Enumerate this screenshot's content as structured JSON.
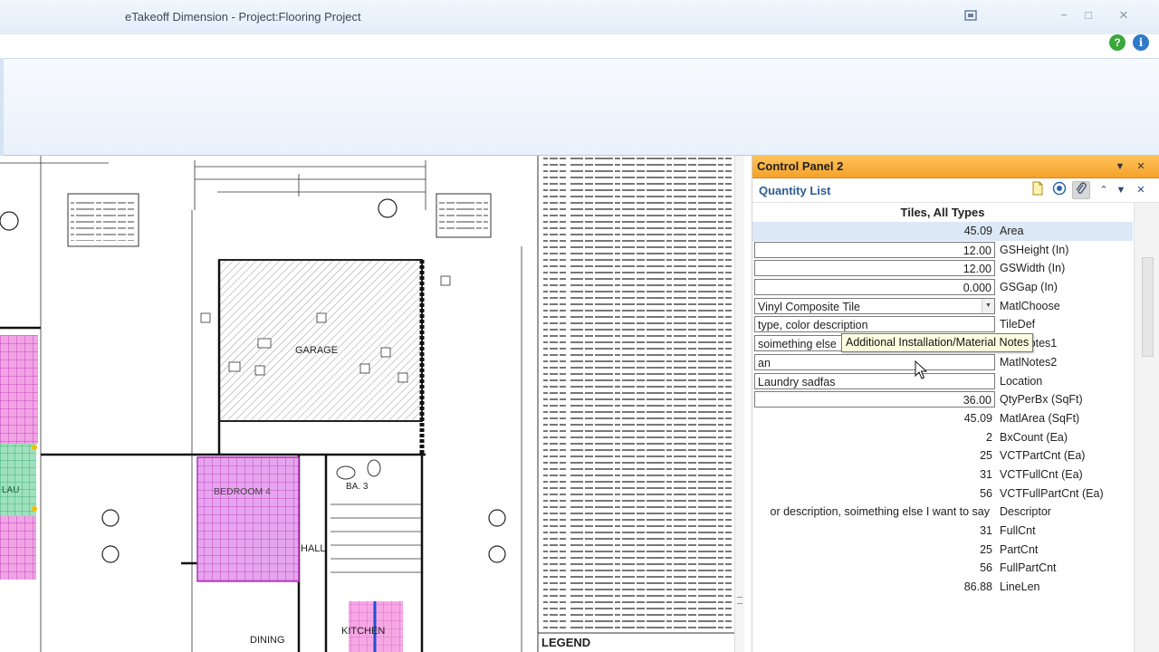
{
  "window": {
    "title": "eTakeoff Dimension - Project:Flooring Project",
    "controls": {
      "minimize": "−",
      "maximize": "□",
      "close": "✕"
    },
    "help_button": "?",
    "info_button": "i"
  },
  "drawing": {
    "room_labels": {
      "garage": "GARAGE",
      "bedroom": "BEDROOM 4",
      "bath": "BA. 3",
      "hall": "HALL",
      "dining": "DINING",
      "kitchen": "KITCHEN",
      "laundry": "LAU"
    },
    "legend": "LEGEND"
  },
  "control_panel": {
    "title": "Control Panel 2",
    "quantity_list": {
      "title": "Quantity List",
      "group_title": "Tiles, All Types",
      "rows": [
        {
          "value": "45.09",
          "label": "Area"
        },
        {
          "value": "12.00",
          "label": "GSHeight (In)"
        },
        {
          "value": "12.00",
          "label": "GSWidth (In)"
        },
        {
          "value": "0.000",
          "label": "GSGap (In)"
        },
        {
          "value": "Vinyl Composite Tile",
          "label": "MatlChoose"
        },
        {
          "value": "type, color description",
          "label": "TileDef"
        },
        {
          "value": "soimething else",
          "label": "MatlNotes1"
        },
        {
          "value": "an",
          "label": "MatlNotes2"
        },
        {
          "value": "Laundry sadfas",
          "label": "Location"
        },
        {
          "value": "36.00",
          "label": "QtyPerBx (SqFt)"
        },
        {
          "value": "45.09",
          "label": "MatlArea (SqFt)"
        },
        {
          "value": "2",
          "label": "BxCount (Ea)"
        },
        {
          "value": "25",
          "label": "VCTPartCnt (Ea)"
        },
        {
          "value": "31",
          "label": "VCTFullCnt (Ea)"
        },
        {
          "value": "56",
          "label": "VCTFullPartCnt (Ea)"
        },
        {
          "value": "or description, soimething else I want to say",
          "label": "Descriptor"
        },
        {
          "value": "31",
          "label": "FullCnt"
        },
        {
          "value": "25",
          "label": "PartCnt"
        },
        {
          "value": "56",
          "label": "FullPartCnt"
        },
        {
          "value": "86.88",
          "label": "LineLen"
        }
      ]
    },
    "tooltip": "Additional Installation/Material Notes"
  },
  "colors": {
    "panel_header": "#f5a12a",
    "quantity_list_title": "#2d5c91",
    "selected_row": "#dce8f6",
    "room_magenta": "#cc33cc",
    "room_pink": "#ff66cc",
    "tooltip_bg": "#ffffe1"
  },
  "icons": [
    "app-icon",
    "help-icon",
    "info-icon",
    "new-document-icon",
    "target-icon",
    "paperclip-icon",
    "collapse-up-icon",
    "dropdown-icon",
    "close-icon"
  ]
}
